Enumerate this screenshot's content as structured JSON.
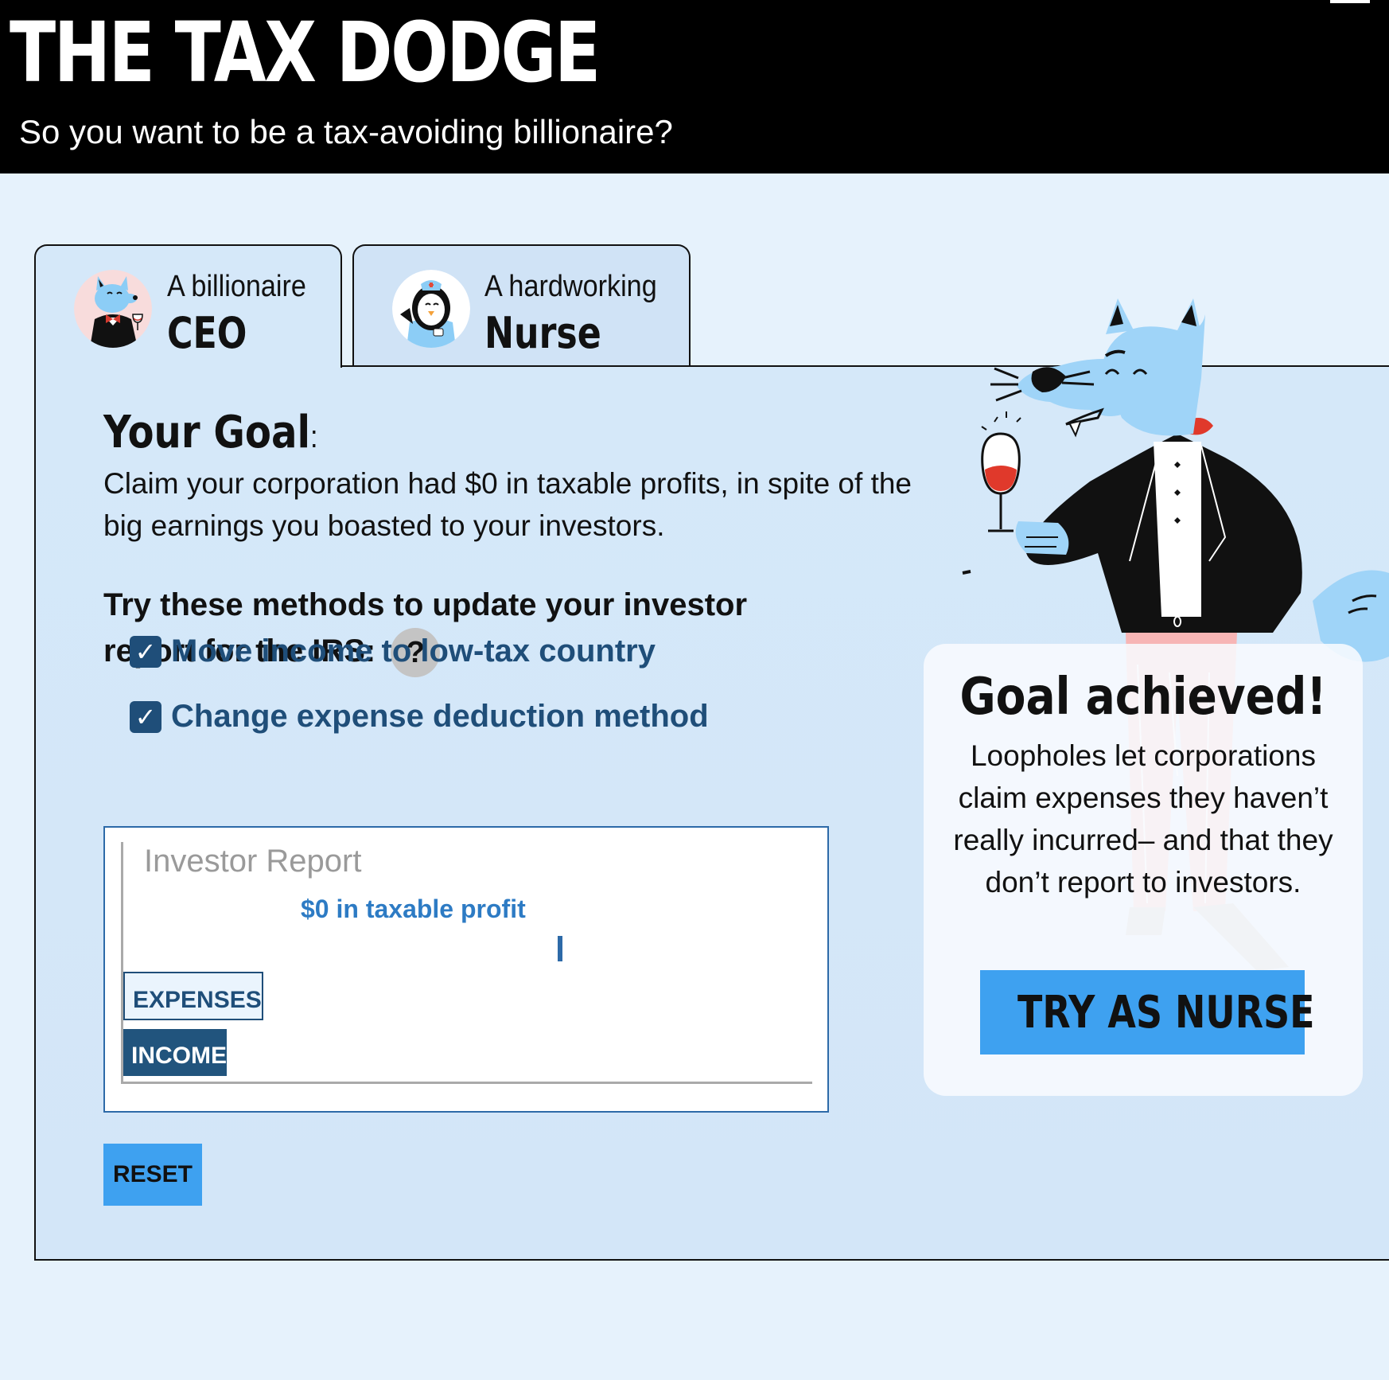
{
  "header": {
    "title": "THE TAX DODGE",
    "subtitle": "So you want to be a tax-avoiding billionaire?"
  },
  "tabs": [
    {
      "small": "A billionaire",
      "big": "CEO",
      "avatar": "wolf-ceo-icon",
      "active": true
    },
    {
      "small": "A hardworking",
      "big": "Nurse",
      "avatar": "penguin-nurse-icon",
      "active": false
    }
  ],
  "goal": {
    "title": "Your Goal",
    "colon": ":",
    "text": "Claim your corporation had $0 in taxable profits, in spite of the big earnings you boasted to your investors."
  },
  "methods": {
    "title": "Try these methods to update your investor report for the IRS:",
    "help": "?",
    "items": [
      {
        "label": "Move income to low-tax country",
        "checked": true,
        "check": "✓"
      },
      {
        "label": "Change expense deduction method",
        "checked": true,
        "check": "✓"
      }
    ]
  },
  "report": {
    "title": "Investor Report",
    "profit_label": "$0 in taxable profit",
    "expenses_label": "EXPENSES",
    "income_label": "INCOME"
  },
  "chart_data": {
    "type": "bar",
    "categories": [
      "EXPENSES",
      "INCOME"
    ],
    "values": [
      1,
      1
    ],
    "title": "Investor Report",
    "annotation": "$0 in taxable profit"
  },
  "reset_label": "RESET",
  "result": {
    "title": "Goal achieved!",
    "text": "Loopholes let corporations claim expenses they haven’t really incurred– and that they don’t report to investors.",
    "button": "TRY AS NURSE"
  },
  "colors": {
    "accent": "#3ea1f0",
    "dark_blue": "#1f4e79",
    "panel": "#d5e8f9",
    "header": "#000000"
  }
}
